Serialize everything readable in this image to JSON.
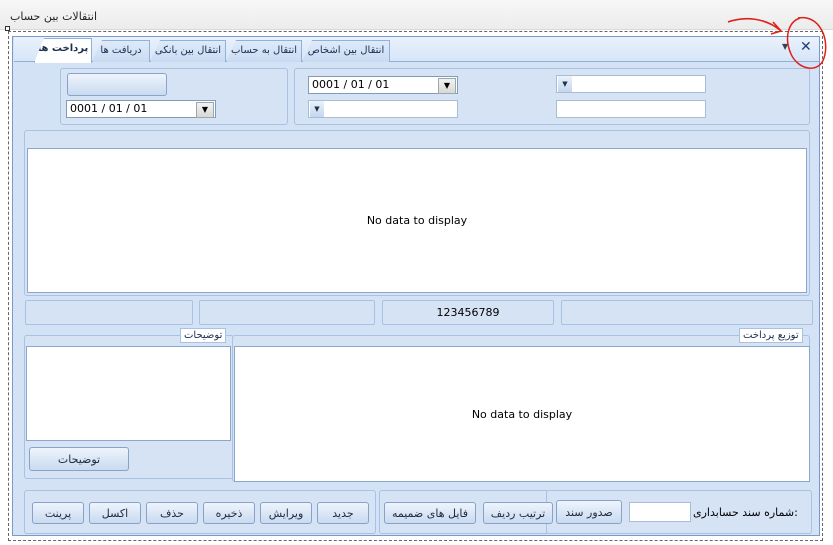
{
  "window": {
    "title": "انتقالات بین حساب"
  },
  "tabs": [
    {
      "label": "پرداخت ها",
      "active": true
    },
    {
      "label": "دریافت ها",
      "active": false
    },
    {
      "label": "انتقال بین بانکی",
      "active": false
    },
    {
      "label": "انتقال به حساب",
      "active": false
    },
    {
      "label": "انتقال بین اشخاص",
      "active": false
    }
  ],
  "header": {
    "date_left": "0001 / 01 / 01",
    "date_mid": "0001 / 01 / 01"
  },
  "main_grid": {
    "empty_text": "No data to display"
  },
  "summary": {
    "field_3": "123456789"
  },
  "notes": {
    "label": "توضیحات",
    "button_label": "توضیحات"
  },
  "payment_distribution": {
    "label": "توزیع پرداخت",
    "empty_text": "No data to display"
  },
  "toolbar": {
    "print": "پرینت",
    "excel": "اکسل",
    "delete": "حذف",
    "save": "ذخیره",
    "edit": "ویرایش",
    "new": "جدید",
    "attachments": "فایل های ضمیمه",
    "row_order": "ترتیب ردیف",
    "issue_document": "صدور سند",
    "doc_number_label": "شماره سند حسابداری:"
  },
  "icons": {
    "close": "close-icon",
    "dropdown": "chevron-down-icon"
  },
  "colors": {
    "form_bg": "#d3e2f5",
    "border": "#7a9bc9",
    "annotation": "#e0201a"
  }
}
